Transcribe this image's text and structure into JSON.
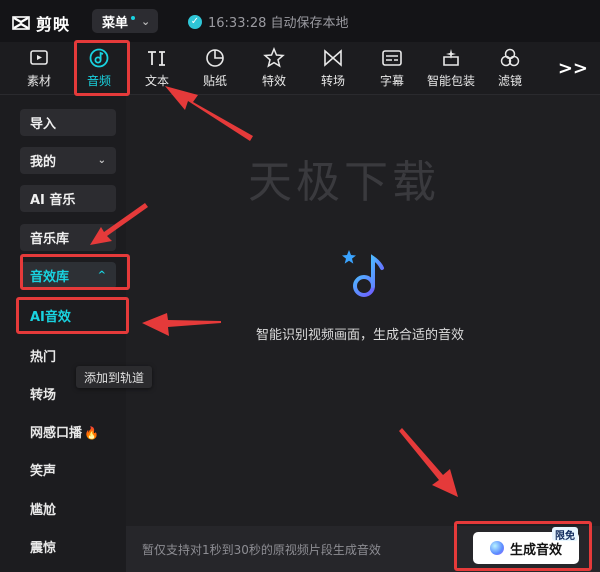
{
  "app": {
    "name": "剪映"
  },
  "header": {
    "menu_label": "菜单",
    "autosave_text": "16:33:28 自动保存本地"
  },
  "toolbar": {
    "tabs": [
      {
        "label": "素材",
        "icon": "play-media-icon"
      },
      {
        "label": "音频",
        "icon": "audio-disc-icon",
        "active": true
      },
      {
        "label": "文本",
        "icon": "text-ti-icon"
      },
      {
        "label": "贴纸",
        "icon": "sticker-icon"
      },
      {
        "label": "特效",
        "icon": "star-effect-icon"
      },
      {
        "label": "转场",
        "icon": "transition-icon"
      },
      {
        "label": "字幕",
        "icon": "subtitle-icon"
      },
      {
        "label": "智能包装",
        "icon": "sparkle-package-icon"
      },
      {
        "label": "滤镜",
        "icon": "filter-icon"
      }
    ],
    "more_label": ">>"
  },
  "sidebar": {
    "buttons": [
      {
        "label": "导入"
      },
      {
        "label": "我的",
        "chevron": "⌄"
      },
      {
        "label": "AI 音乐"
      },
      {
        "label": "音乐库"
      },
      {
        "label": "音效库",
        "chevron": "^",
        "active": true
      }
    ],
    "items": [
      {
        "label": "AI音效",
        "active": true
      },
      {
        "label": "热门"
      },
      {
        "label": "转场"
      },
      {
        "label": "网感口播"
      },
      {
        "label": "笑声"
      },
      {
        "label": "尴尬"
      },
      {
        "label": "震惊"
      }
    ]
  },
  "main": {
    "watermark": "天极下载",
    "hint": "智能识别视频画面，生成合适的音效"
  },
  "tooltip": {
    "text": "添加到轨道"
  },
  "footer": {
    "note": "暂仅支持对1秒到30秒的原视频片段生成音效",
    "generate_label": "生成音效",
    "badge": "限免"
  },
  "colors": {
    "accent": "#19d3e0",
    "highlight": "#e53a3a",
    "background": "#1f1f22"
  }
}
